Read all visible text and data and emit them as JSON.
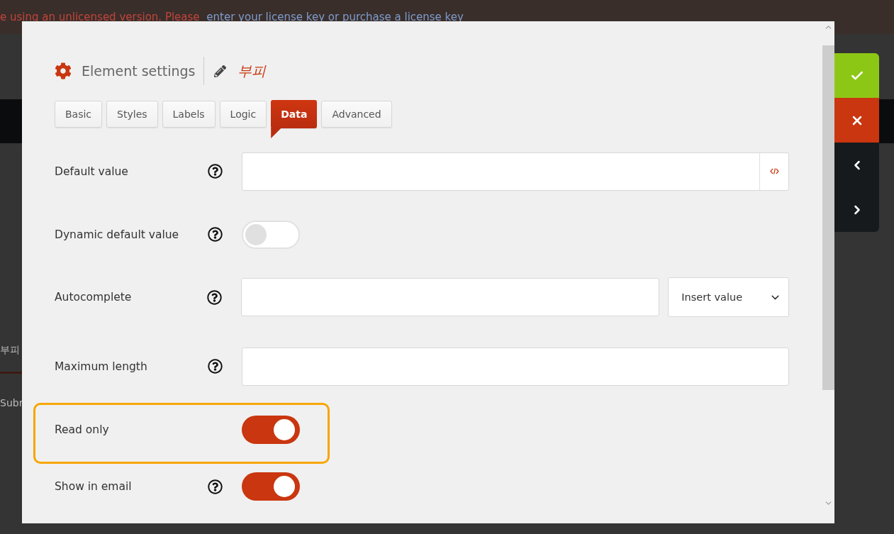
{
  "banner": {
    "text": "e using an unlicensed version. Please ",
    "link": "enter your license key or purchase a license key"
  },
  "background": {
    "labels": [
      "부피",
      "Subr"
    ]
  },
  "modal": {
    "title": "Element settings",
    "element_name": "부피"
  },
  "tabs": [
    {
      "label": "Basic",
      "selected": false
    },
    {
      "label": "Styles",
      "selected": false
    },
    {
      "label": "Labels",
      "selected": false
    },
    {
      "label": "Logic",
      "selected": false
    },
    {
      "label": "Data",
      "selected": true
    },
    {
      "label": "Advanced",
      "selected": false
    }
  ],
  "fields": [
    {
      "kind": "code-input",
      "label": "Default value",
      "help": true,
      "highlighted": false
    },
    {
      "kind": "toggle",
      "label": "Dynamic default value",
      "help": true,
      "highlighted": false,
      "on": false
    },
    {
      "kind": "input-select",
      "label": "Autocomplete",
      "help": true,
      "highlighted": false,
      "select": "Insert value"
    },
    {
      "kind": "input",
      "label": "Maximum length",
      "help": true,
      "highlighted": false
    },
    {
      "kind": "toggle",
      "label": "Read only",
      "help": false,
      "highlighted": true,
      "on": true
    },
    {
      "kind": "toggle",
      "label": "Show in email",
      "help": true,
      "highlighted": false,
      "on": true
    }
  ],
  "actions": [
    {
      "kind": "confirm"
    },
    {
      "kind": "cancel"
    },
    {
      "kind": "previous"
    },
    {
      "kind": "next"
    }
  ]
}
